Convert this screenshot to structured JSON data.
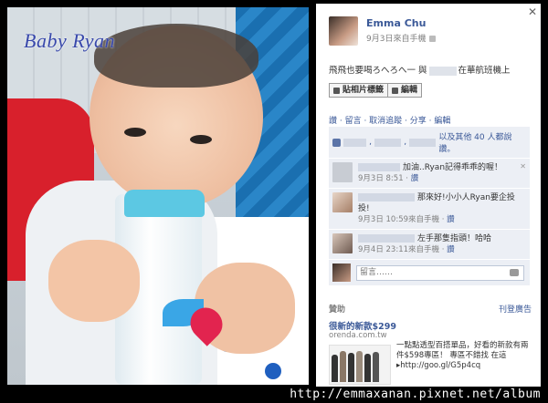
{
  "photo": {
    "title": "Baby Ryan"
  },
  "post": {
    "author": "Emma Chu",
    "meta": "9月3日來自手機",
    "status_prefix": "飛飛也要喝ろへろへ一 與",
    "status_suffix": "在華航班機上",
    "tag_button": "貼相片標籤",
    "edit_button": "編輯",
    "action_links": "讚 · 留言 · 取消追蹤 · 分享 · 編輯"
  },
  "likes": {
    "text": "以及其他 40 人都說讚。"
  },
  "comments": [
    {
      "text": "加油..Ryan記得乖乖的喔！",
      "time": "9月3日 8:51",
      "like": "讚"
    },
    {
      "text": "那來好!小小人Ryan要企投投!",
      "time": "9月3日 10:59來自手機",
      "like": "讚"
    },
    {
      "text": "左手那隻指頭！哈哈",
      "time": "9月4日 23:11來自手機",
      "like": "讚"
    }
  ],
  "comment_input": {
    "placeholder": "留言……"
  },
  "sponsored": {
    "label": "贊助",
    "create_ad": "刊登廣告",
    "ad_title": "很新的新款$299",
    "ad_url": "orenda.com.tw",
    "ad_text": "一點點透型百搭單品，好看的新款有兩件$598專區！ 專區不錯找 在這 ▸http://goo.gl/G5p4cq"
  },
  "watermark": "http://emmaxanan.pixnet.net/album"
}
